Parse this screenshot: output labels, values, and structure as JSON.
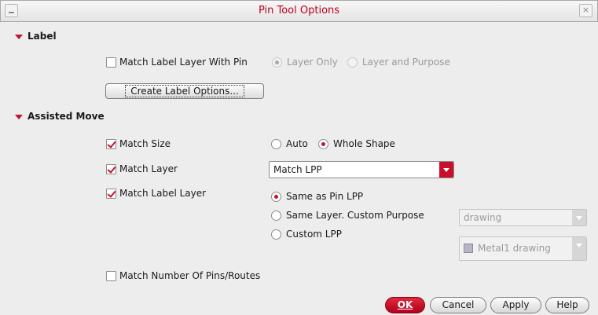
{
  "window": {
    "title": "Pin Tool Options",
    "close_glyph": "×"
  },
  "label_section": {
    "heading": "Label",
    "match_label_layer_with_pin": {
      "label": "Match Label Layer With Pin",
      "checked": false
    },
    "radio_layer_only": {
      "label": "Layer Only",
      "selected": true,
      "enabled": false
    },
    "radio_layer_and_purpose": {
      "label": "Layer and Purpose",
      "selected": false,
      "enabled": false
    },
    "create_label_options": "Create Label Options..."
  },
  "assisted_move_section": {
    "heading": "Assisted Move",
    "match_size": {
      "label": "Match Size",
      "checked": true
    },
    "radio_auto": {
      "label": "Auto",
      "selected": false
    },
    "radio_whole_shape": {
      "label": "Whole Shape",
      "selected": true
    },
    "match_layer": {
      "label": "Match Layer",
      "checked": true
    },
    "match_layer_combo": "Match LPP",
    "match_label_layer": {
      "label": "Match Label Layer",
      "checked": true
    },
    "radio_same_as_pin_lpp": {
      "label": "Same as Pin LPP",
      "selected": true
    },
    "radio_same_layer_custom_purpose": {
      "label": "Same Layer. Custom Purpose",
      "selected": false
    },
    "purpose_combo": "drawing",
    "radio_custom_lpp": {
      "label": "Custom LPP",
      "selected": false
    },
    "lpp_combo": "Metal1 drawing",
    "match_number_of_pins": {
      "label": "Match Number Of Pins/Routes",
      "checked": false
    }
  },
  "footer": {
    "ok": "OK",
    "cancel": "Cancel",
    "apply": "Apply",
    "help": "Help"
  },
  "colors": {
    "accent": "#c8102e",
    "background": "#ededed"
  }
}
